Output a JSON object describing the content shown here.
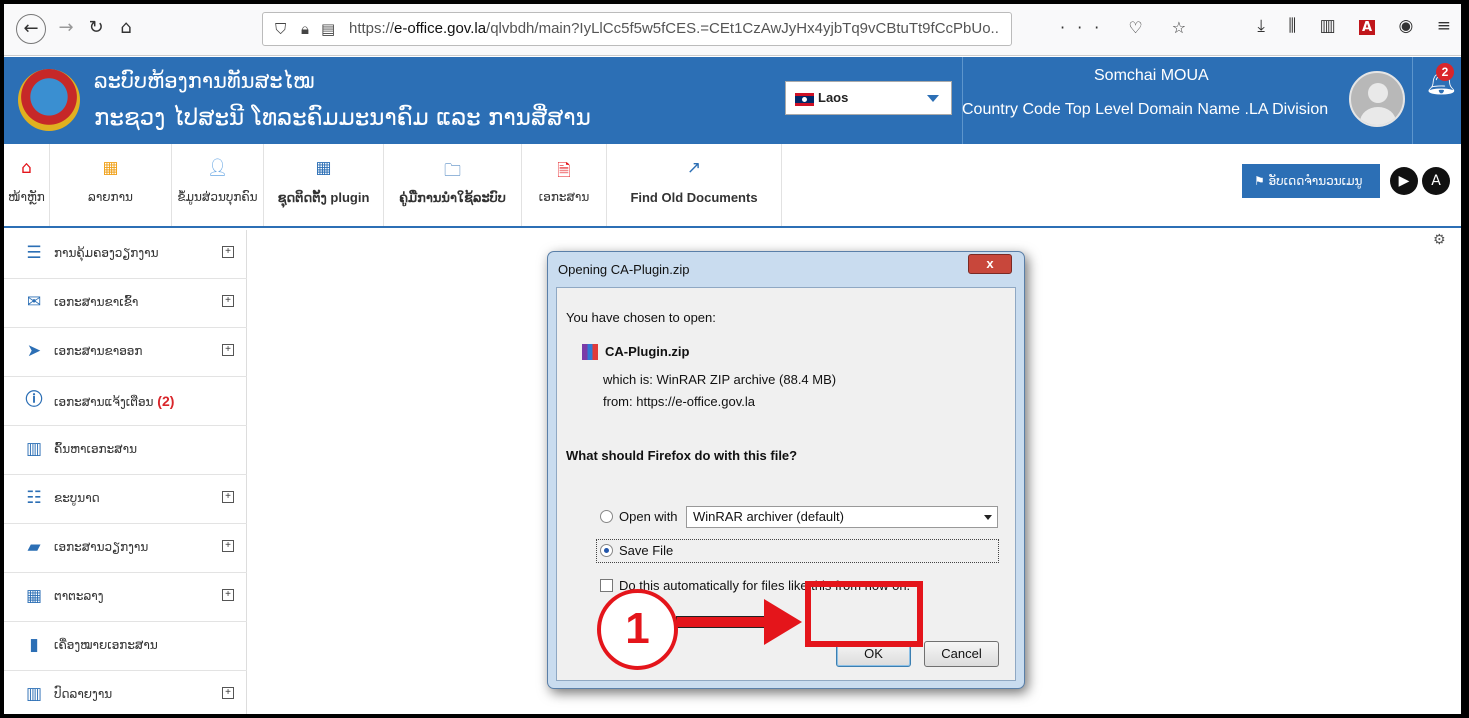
{
  "browser": {
    "url_prefix": "https://",
    "url_domain": "e-office.gov.la",
    "url_path": "/qlvbdh/main?IyLlCc5f5w5fCES.=CEt1CzAwJyHx4yjbTq9vCBtuTt9fCcPbUo..",
    "page_actions": "··· ♡ ☆"
  },
  "header": {
    "title_line1": "ລະບົບຫ້ອງການທັນສະໄໝ",
    "title_line2": "ກະຊວງ ໄປສະນີ ໂທລະຄົມມະນາຄົມ ແລະ ການສື່ສານ",
    "language": "Laos",
    "user_name": "Somchai MOUA",
    "user_department": "Country Code Top Level Domain Name .LA Division",
    "notification_count": "2"
  },
  "top_menu": [
    {
      "label": "ໜ້າຫຼັກ",
      "icon": "home-icon",
      "color": "#e4151b"
    },
    {
      "label": "ລາຍການ",
      "icon": "grid-icon",
      "color": "#f0a11a"
    },
    {
      "label": "ຂໍ້ມູນສ່ວນບຸກຄົນ",
      "icon": "user-icon",
      "color": "#6aa8e4"
    },
    {
      "label": "ຊຸດຕິດຕັ້ງ plugin",
      "icon": "calendar-icon",
      "color": "#2c6fb5"
    },
    {
      "label": "ຄູ່ມືການນຳໃຊ້ລະບົບ",
      "icon": "folder-icon",
      "color": "#2c6fb5"
    },
    {
      "label": "ເອກະສານ",
      "icon": "document-icon",
      "color": "#e4151b"
    },
    {
      "label": "Find Old Documents",
      "icon": "external-link-icon",
      "color": "#2c6fb5"
    }
  ],
  "report_button": "ອັບເດດຈໍານວນເມນູ",
  "sidebar": [
    {
      "label": "ການຄຸ້ມຄອງວຽກງານ",
      "icon": "tasks-icon",
      "expand": true
    },
    {
      "label": "ເອກະສານຂາເຂົ້າ",
      "icon": "envelope-icon",
      "expand": true
    },
    {
      "label": "ເອກະສານຂາອອກ",
      "icon": "send-icon",
      "expand": true
    },
    {
      "label": "ເອກະສານແຈ້ງເຕືອນ",
      "icon": "info-icon",
      "count": "(2)",
      "expand": false
    },
    {
      "label": "ຄົ້ນຫາເອກະສານ",
      "icon": "chart-icon",
      "expand": false
    },
    {
      "label": "ຂະບູນາດ",
      "icon": "list-icon",
      "expand": true
    },
    {
      "label": "ເອກະສານວຽກງານ",
      "icon": "book-icon",
      "expand": true
    },
    {
      "label": "ຕາຕະລາງ",
      "icon": "calendar-icon",
      "expand": true
    },
    {
      "label": "ເຄື່ອງໝາຍເອກະສານ",
      "icon": "bookmark-icon",
      "expand": false
    },
    {
      "label": "ປົດລາຍງານ",
      "icon": "bar-chart-icon",
      "expand": true
    }
  ],
  "dialog": {
    "title": "Opening CA-Plugin.zip",
    "close_label": "x",
    "chosen_text": "You have chosen to open:",
    "file_name": "CA-Plugin.zip",
    "which_is": "which is:  WinRAR ZIP archive (88.4 MB)",
    "from": "from:  https://e-office.gov.la",
    "question": "What should Firefox do with this file?",
    "open_with_label": "Open with",
    "open_with_value": "WinRAR archiver (default)",
    "save_file_label": "Save File",
    "auto_label": "Do this automatically for files like this from now on.",
    "ok_label": "OK",
    "cancel_label": "Cancel"
  },
  "annotation": {
    "step_number": "1",
    "color": "#e4151b"
  }
}
